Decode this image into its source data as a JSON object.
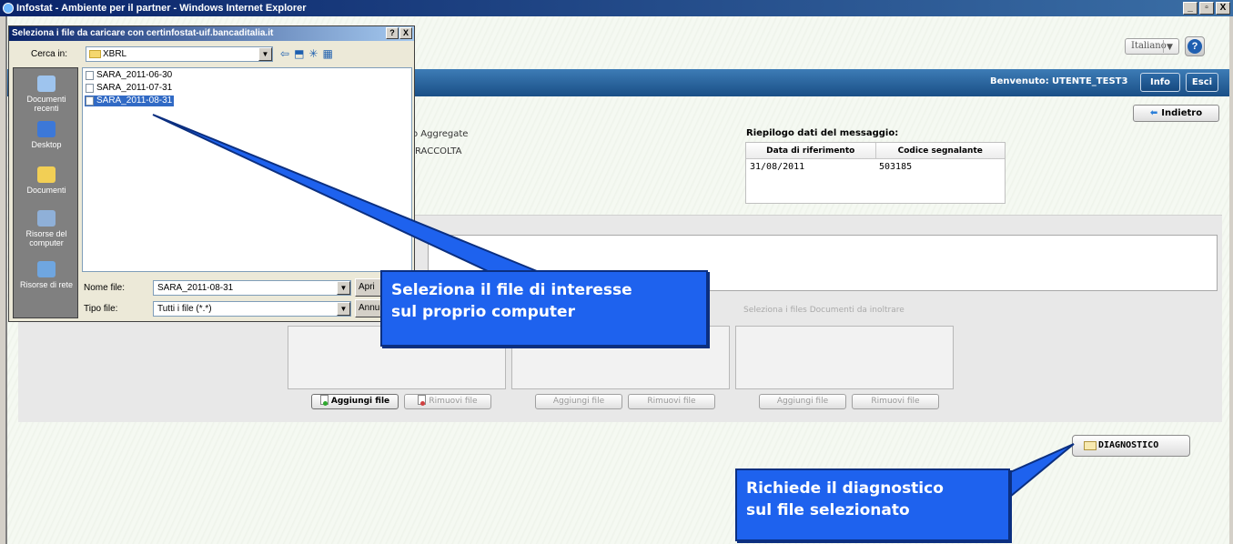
{
  "ie_window": {
    "title": "Infostat - Ambiente per il partner - Windows Internet Explorer",
    "controls": [
      "_",
      " ",
      "X"
    ]
  },
  "app": {
    "language": "Italiano",
    "welcome_label": "Benvenuto:",
    "user": "UTENTE_TEST3",
    "info_label": "Info",
    "exit_label": "Esci",
    "back_label": "Indietro",
    "partial_text_1": "o Aggregate",
    "partial_text_2": "RACCOLTA",
    "summary": {
      "title": "Riepilogo dati del messaggio:",
      "headers": [
        "Data di riferimento",
        "Codice segnalante"
      ],
      "row": [
        "31/08/2011",
        "503185"
      ]
    },
    "docs_label": "Seleziona i files Documenti da inoltrare",
    "add_file_label": "Aggiungi file",
    "remove_file_label": "Rimuovi file",
    "diagnostic_label": "DIAGNOSTICO"
  },
  "file_dialog": {
    "title": "Seleziona i file da caricare con certinfostat-uif.bancaditalia.it",
    "help": "?",
    "close": "X",
    "look_in_label": "Cerca in:",
    "look_in_value": "XBRL",
    "places": [
      "Documenti recenti",
      "Desktop",
      "Documenti",
      "Risorse del computer",
      "Risorse di rete"
    ],
    "files": [
      "SARA_2011-06-30",
      "SARA_2011-07-31",
      "SARA_2011-08-31"
    ],
    "selected_file": "SARA_2011-08-31",
    "filename_label": "Nome file:",
    "filename_value": "SARA_2011-08-31",
    "filetype_label": "Tipo file:",
    "filetype_value": "Tutti i file (*.*)",
    "open_label": "Apri",
    "cancel_label": "Annulla"
  },
  "callouts": {
    "select_file_line1": "Seleziona il file di interesse",
    "select_file_line2": "sul proprio computer",
    "diagnostic_line1": "Richiede il diagnostico",
    "diagnostic_line2": "sul file selezionato"
  },
  "colors": {
    "callout_blue": "#1e62ee",
    "navbar_blue": "#1a4f86",
    "selection_blue": "#316ac5"
  }
}
